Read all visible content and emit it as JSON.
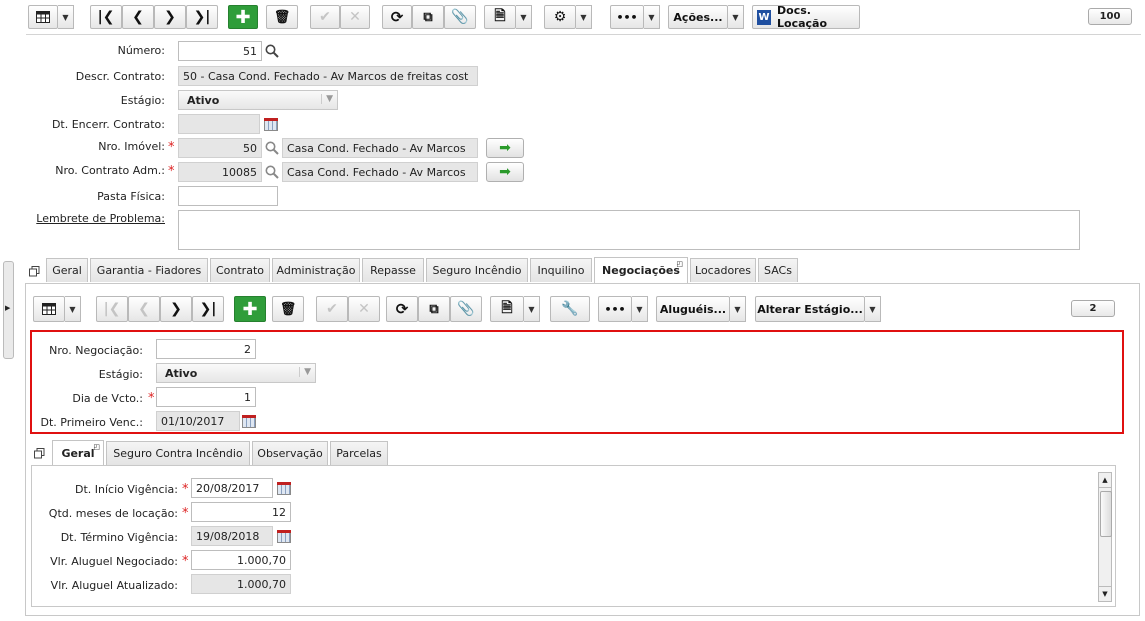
{
  "toolbar_top": {
    "acoes_label": "Ações...",
    "docs_label": "Docs. Locação",
    "docs_icon_letter": "W",
    "pager": "100"
  },
  "form": {
    "numero": {
      "label": "Número:",
      "value": "51"
    },
    "descr": {
      "label": "Descr. Contrato:",
      "value": "50 - Casa Cond. Fechado - Av Marcos de freitas cost"
    },
    "estagio": {
      "label": "Estágio:",
      "value": "Ativo"
    },
    "dt_encerr": {
      "label": "Dt. Encerr. Contrato:",
      "value": ""
    },
    "nro_imovel": {
      "label": "Nro. Imóvel:",
      "value": "50",
      "desc": "Casa Cond. Fechado - Av Marcos"
    },
    "nro_contrato_adm": {
      "label": "Nro. Contrato Adm.:",
      "value": "10085",
      "desc": "Casa Cond. Fechado - Av Marcos"
    },
    "pasta_fisica": {
      "label": "Pasta Física:",
      "value": ""
    },
    "lembrete": {
      "label": "Lembrete de Problema:",
      "value": ""
    }
  },
  "tabs": [
    "Geral",
    "Garantia - Fiadores",
    "Contrato",
    "Administração",
    "Repasse",
    "Seguro Incêndio",
    "Inquilino",
    "Negociações",
    "Locadores",
    "SACs"
  ],
  "active_tab": "Negociações",
  "neg_toolbar": {
    "alugueis_label": "Aluguéis...",
    "alterar_label": "Alterar Estágio...",
    "pager": "2"
  },
  "negociacao": {
    "nro": {
      "label": "Nro. Negociação:",
      "value": "2"
    },
    "estagio": {
      "label": "Estágio:",
      "value": "Ativo"
    },
    "dia_vcto": {
      "label": "Dia de Vcto.:",
      "value": "1"
    },
    "dt_primeiro": {
      "label": "Dt. Primeiro Venc.:",
      "value": "01/10/2017"
    }
  },
  "subtabs": [
    "Geral",
    "Seguro Contra Incêndio",
    "Observação",
    "Parcelas"
  ],
  "geral": {
    "dt_inicio": {
      "label": "Dt. Início Vigência:",
      "value": "20/08/2017"
    },
    "qtd_meses": {
      "label": "Qtd. meses de locação:",
      "value": "12"
    },
    "dt_termino": {
      "label": "Dt. Término Vigência:",
      "value": "19/08/2018"
    },
    "vlr_negociado": {
      "label": "Vlr. Aluguel Negociado:",
      "value": "1.000,70"
    },
    "vlr_atualizado": {
      "label": "Vlr. Aluguel Atualizado:",
      "value": "1.000,70"
    }
  },
  "colors": {
    "highlight": "#e01010",
    "green_button": "#2f9d3a"
  }
}
